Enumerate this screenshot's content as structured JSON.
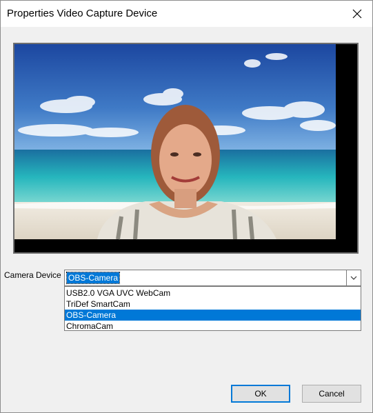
{
  "window": {
    "title": "Properties Video Capture Device"
  },
  "camera": {
    "label": "Camera Device",
    "selected": "OBS-Camera",
    "options": [
      "USB2.0 VGA UVC WebCam",
      "TriDef SmartCam",
      "OBS-Camera",
      "ChromaCam"
    ]
  },
  "buttons": {
    "ok": "OK",
    "cancel": "Cancel"
  },
  "colors": {
    "accent": "#0078d7",
    "sky": "#2d5aa8",
    "sea": "#1fb0b8",
    "sand": "#e8e2d6"
  }
}
